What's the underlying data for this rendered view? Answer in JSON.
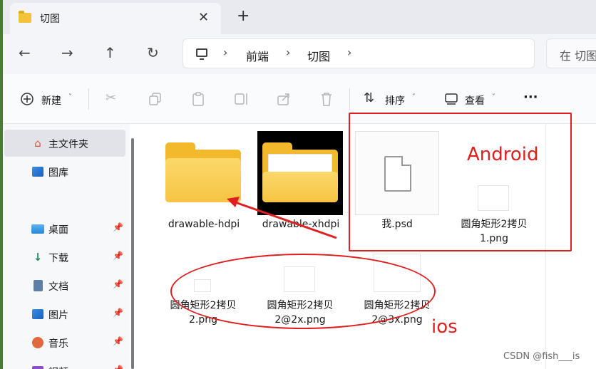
{
  "window": {
    "tab_title": "切图",
    "tab_close": "✕",
    "new_tab": "+"
  },
  "nav": {
    "back": "←",
    "forward": "→",
    "up": "↑",
    "refresh": "↻"
  },
  "breadcrumb": {
    "sep": "›",
    "items": [
      "前端",
      "切图"
    ]
  },
  "search": {
    "placeholder": "在 切图"
  },
  "toolbar": {
    "new_label": "新建",
    "sort_label": "排序",
    "view_label": "查看",
    "more": "···",
    "chevron": "˅"
  },
  "sidebar": {
    "items": [
      {
        "label": "主文件夹",
        "icon": "home-icon",
        "pinned": false
      },
      {
        "label": "图库",
        "icon": "gallery-icon",
        "pinned": false
      },
      {
        "label": "桌面",
        "icon": "desktop-icon",
        "pinned": true
      },
      {
        "label": "下载",
        "icon": "download-icon",
        "pinned": true
      },
      {
        "label": "文档",
        "icon": "document-icon",
        "pinned": true
      },
      {
        "label": "图片",
        "icon": "pictures-icon",
        "pinned": true
      },
      {
        "label": "音乐",
        "icon": "music-icon",
        "pinned": true
      },
      {
        "label": "视频",
        "icon": "video-icon",
        "pinned": true
      }
    ]
  },
  "files": {
    "folder1": "drawable-hdpi",
    "folder2": "drawable-xhdpi",
    "psd": "我.psd",
    "png1_line1": "圆角矩形2拷贝",
    "png1_line2": "1.png",
    "png2_line1": "圆角矩形2拷贝",
    "png2_line2": "2.png",
    "png3_line1": "圆角矩形2拷贝",
    "png3_line2": "2@2x.png",
    "png4_line1": "圆角矩形2拷贝",
    "png4_line2": "2@3x.png"
  },
  "annotations": {
    "android": "Android",
    "ios": "ios",
    "color": "#e02020"
  },
  "watermark": "CSDN @fish___is"
}
